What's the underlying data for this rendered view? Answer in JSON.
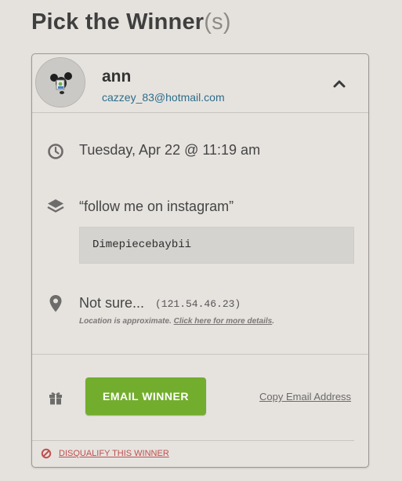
{
  "page": {
    "title": "Pick the Winner",
    "title_suffix": "(s)"
  },
  "winner": {
    "name": "ann",
    "email": "cazzey_83@hotmail.com",
    "entry_time": "Tuesday, Apr 22 @ 11:19 am",
    "entry_action": "“follow me on instagram”",
    "entry_value": "Dimepiecebaybii",
    "location": "Not sure...",
    "ip": "(121.54.46.23)",
    "location_note": "Location is approximate.",
    "location_link": "Click here for more details",
    "location_note_end": "."
  },
  "actions": {
    "email_button": "EMAIL WINNER",
    "copy_email": "Copy Email Address",
    "disqualify": "DISQUALIFY THIS WINNER"
  },
  "icons": {
    "time": "clock-icon",
    "entry": "layers-icon",
    "location": "map-pin-icon",
    "prize": "gift-icon",
    "disqualify": "prohibited-icon",
    "collapse": "chevron-up-icon"
  },
  "colors": {
    "background": "#e5e2de",
    "accent_green": "#73ad2d",
    "email_link": "#2d6d8a",
    "danger": "#c0504d",
    "icon_gray": "#6e6c6a"
  }
}
